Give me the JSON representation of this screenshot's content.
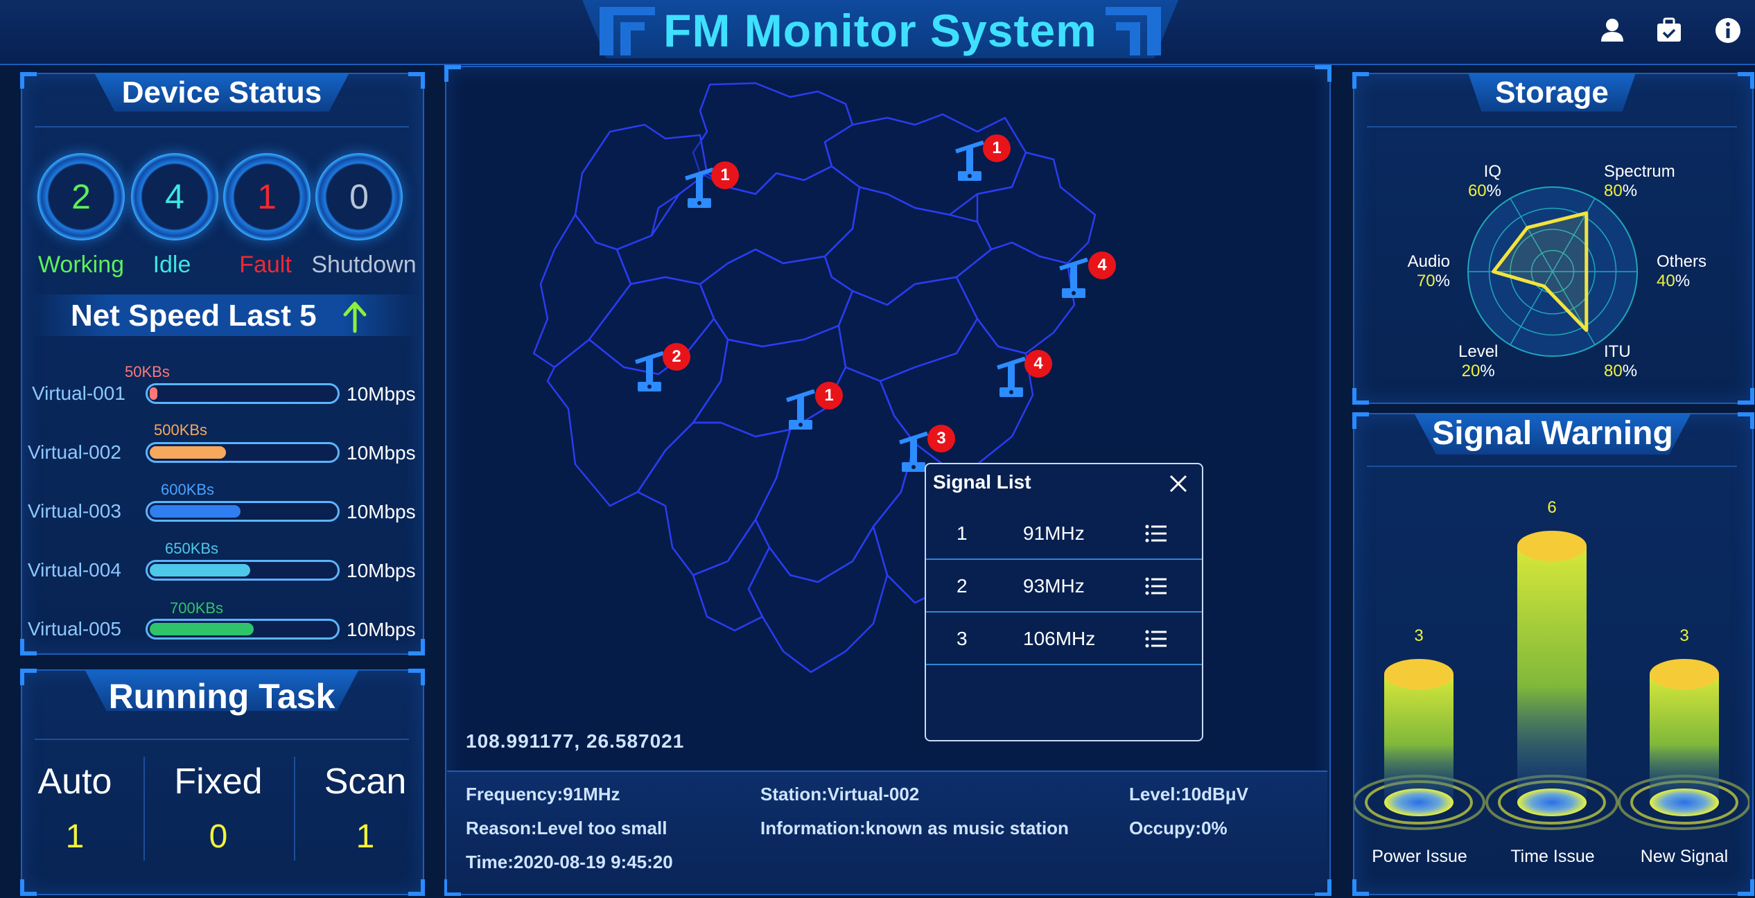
{
  "header": {
    "title": "FM Monitor System",
    "icons": [
      "user-icon",
      "briefcase-icon",
      "info-icon"
    ]
  },
  "device_status": {
    "title": "Device Status",
    "items": [
      {
        "count": "2",
        "label": "Working",
        "color": "#5cf05a"
      },
      {
        "count": "4",
        "label": "Idle",
        "color": "#3fe6e0"
      },
      {
        "count": "1",
        "label": "Fault",
        "color": "#f02830"
      },
      {
        "count": "0",
        "label": "Shutdown",
        "color": "#b8c4d8"
      }
    ],
    "net_speed_title": "Net Speed Last 5",
    "net_speed": [
      {
        "name": "Virtual-001",
        "value": "50KBs",
        "max": "10Mbps",
        "fraction": 0.04,
        "color": "#ff7878"
      },
      {
        "name": "Virtual-002",
        "value": "500KBs",
        "max": "10Mbps",
        "fraction": 0.41,
        "color": "#f6a85c"
      },
      {
        "name": "Virtual-003",
        "value": "600KBs",
        "max": "10Mbps",
        "fraction": 0.49,
        "color": "#2f7ff0"
      },
      {
        "name": "Virtual-004",
        "value": "650KBs",
        "max": "10Mbps",
        "fraction": 0.54,
        "color": "#4ec8e8"
      },
      {
        "name": "Virtual-005",
        "value": "700KBs",
        "max": "10Mbps",
        "fraction": 0.56,
        "color": "#2fc46a"
      }
    ]
  },
  "running_task": {
    "title": "Running Task",
    "items": [
      {
        "label": "Auto",
        "value": "1"
      },
      {
        "label": "Fixed",
        "value": "0"
      },
      {
        "label": "Scan",
        "value": "1"
      }
    ]
  },
  "map": {
    "stations": [
      {
        "badge": "1"
      },
      {
        "badge": "1"
      },
      {
        "badge": "4"
      },
      {
        "badge": "2"
      },
      {
        "badge": "4"
      },
      {
        "badge": "1"
      },
      {
        "badge": "3"
      }
    ],
    "coordinates": "108.991177, 26.587021"
  },
  "signal_list": {
    "title": "Signal List",
    "rows": [
      {
        "num": "1",
        "freq": "91MHz"
      },
      {
        "num": "2",
        "freq": "93MHz"
      },
      {
        "num": "3",
        "freq": "106MHz"
      }
    ]
  },
  "info": {
    "frequency": "Frequency:91MHz",
    "station": "Station:Virtual-002",
    "level": "Level:10dBμV",
    "reason": "Reason:Level too small",
    "information": "Information:known as music station",
    "occupy": "Occupy:0%",
    "time": "Time:2020-08-19 9:45:20"
  },
  "storage": {
    "title": "Storage",
    "axes": [
      {
        "name": "Spectrum",
        "pct": "80"
      },
      {
        "name": "Others",
        "pct": "40"
      },
      {
        "name": "ITU",
        "pct": "80"
      },
      {
        "name": "Level",
        "pct": "20"
      },
      {
        "name": "Audio",
        "pct": "70"
      },
      {
        "name": "IQ",
        "pct": "60"
      }
    ],
    "pct_sign": "%"
  },
  "signal_warning": {
    "title": "Signal Warning",
    "bars": [
      {
        "label": "Power Issue",
        "value": "3"
      },
      {
        "label": "Time Issue",
        "value": "6"
      },
      {
        "label": "New Signal",
        "value": "3"
      }
    ]
  }
}
